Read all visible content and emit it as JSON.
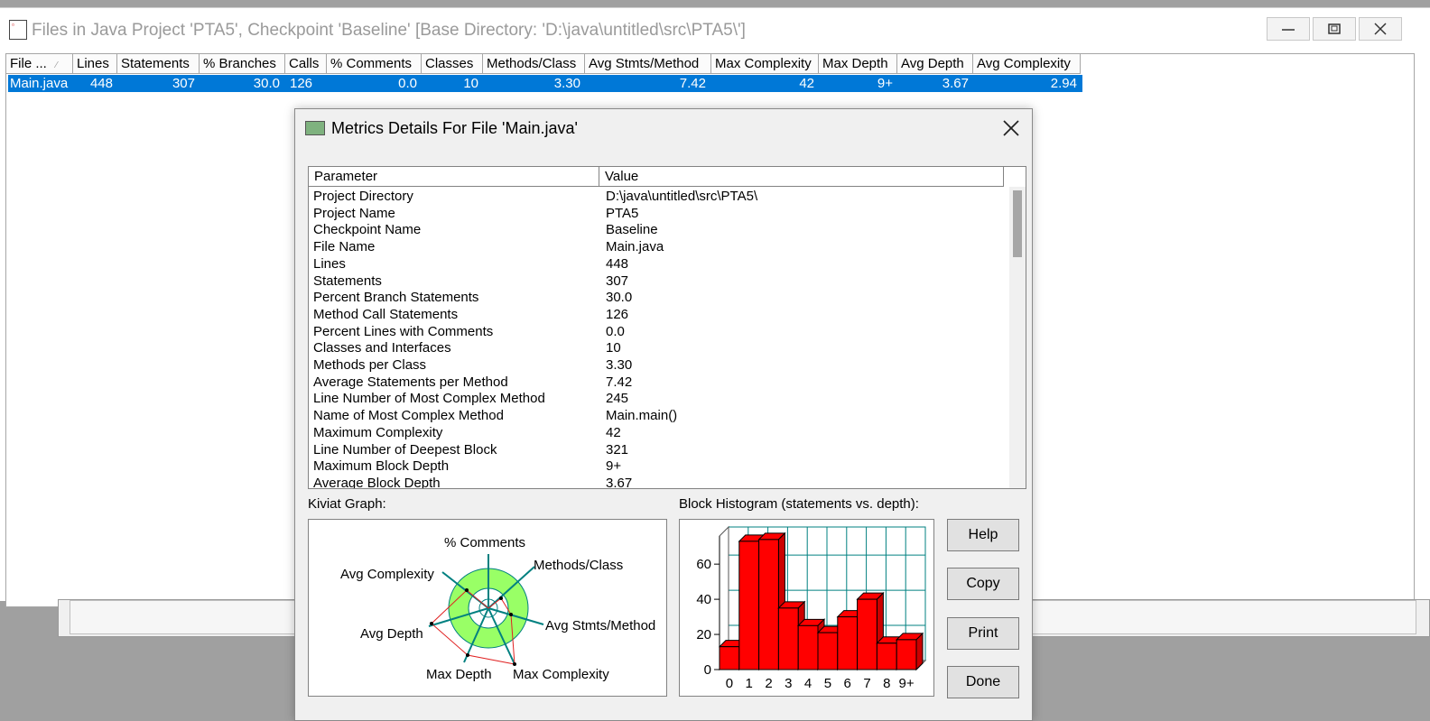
{
  "window": {
    "title": "Files in Java Project 'PTA5', Checkpoint 'Baseline'  [Base Directory: 'D:\\java\\untitled\\src\\PTA5\\']",
    "icon": "document-icon"
  },
  "grid": {
    "columns": [
      "File ...",
      "Lines",
      "Statements",
      "% Branches",
      "Calls",
      "% Comments",
      "Classes",
      "Methods/Class",
      "Avg Stmts/Method",
      "Max Complexity",
      "Max Depth",
      "Avg Depth",
      "Avg Complexity"
    ],
    "row": [
      "Main.java",
      "448",
      "307",
      "30.0",
      "126",
      "0.0",
      "10",
      "3.30",
      "7.42",
      "42",
      "9+",
      "3.67",
      "2.94"
    ]
  },
  "dialog": {
    "title": "Metrics Details For File 'Main.java'",
    "list_headers": [
      "Parameter",
      "Value"
    ],
    "rows": [
      [
        "Project Directory",
        "D:\\java\\untitled\\src\\PTA5\\"
      ],
      [
        "Project Name",
        "PTA5"
      ],
      [
        "Checkpoint Name",
        "Baseline"
      ],
      [
        "File Name",
        "Main.java"
      ],
      [
        "Lines",
        "448"
      ],
      [
        "Statements",
        "307"
      ],
      [
        "Percent Branch Statements",
        "30.0"
      ],
      [
        "Method Call Statements",
        "126"
      ],
      [
        "Percent Lines with Comments",
        "0.0"
      ],
      [
        "Classes and Interfaces",
        "10"
      ],
      [
        "Methods per Class",
        "3.30"
      ],
      [
        "Average Statements per Method",
        "7.42"
      ],
      [
        "Line Number of Most Complex Method",
        "245"
      ],
      [
        "Name of Most Complex Method",
        "Main.main()"
      ],
      [
        "Maximum Complexity",
        "42"
      ],
      [
        "Line Number of Deepest Block",
        "321"
      ],
      [
        "Maximum Block Depth",
        "9+"
      ],
      [
        "Average Block Depth",
        "3.67"
      ]
    ],
    "kiviat_label": "Kiviat Graph:",
    "histogram_label": "Block Histogram (statements vs. depth):",
    "buttons": {
      "help": "Help",
      "copy": "Copy",
      "print": "Print",
      "done": "Done"
    }
  },
  "kiviat": {
    "axes": [
      "% Comments",
      "Methods/Class",
      "Avg Stmts/Method",
      "Max Complexity",
      "Max Depth",
      "Avg Depth",
      "Avg Complexity"
    ],
    "colors": {
      "ring": "#99ff66",
      "axis": "#008080",
      "polygon": "#e02020"
    }
  },
  "chart_data": {
    "type": "bar",
    "title": "Block Histogram (statements vs. depth):",
    "categories": [
      "0",
      "1",
      "2",
      "3",
      "4",
      "5",
      "6",
      "7",
      "8",
      "9+"
    ],
    "values": [
      13,
      73,
      74,
      35,
      25,
      21,
      30,
      40,
      15,
      17
    ],
    "ylim": [
      0,
      76
    ],
    "yticks": [
      "0",
      "20",
      "40",
      "60"
    ],
    "xlabel": "",
    "ylabel": "",
    "grid": true,
    "color": "#ff0000"
  }
}
